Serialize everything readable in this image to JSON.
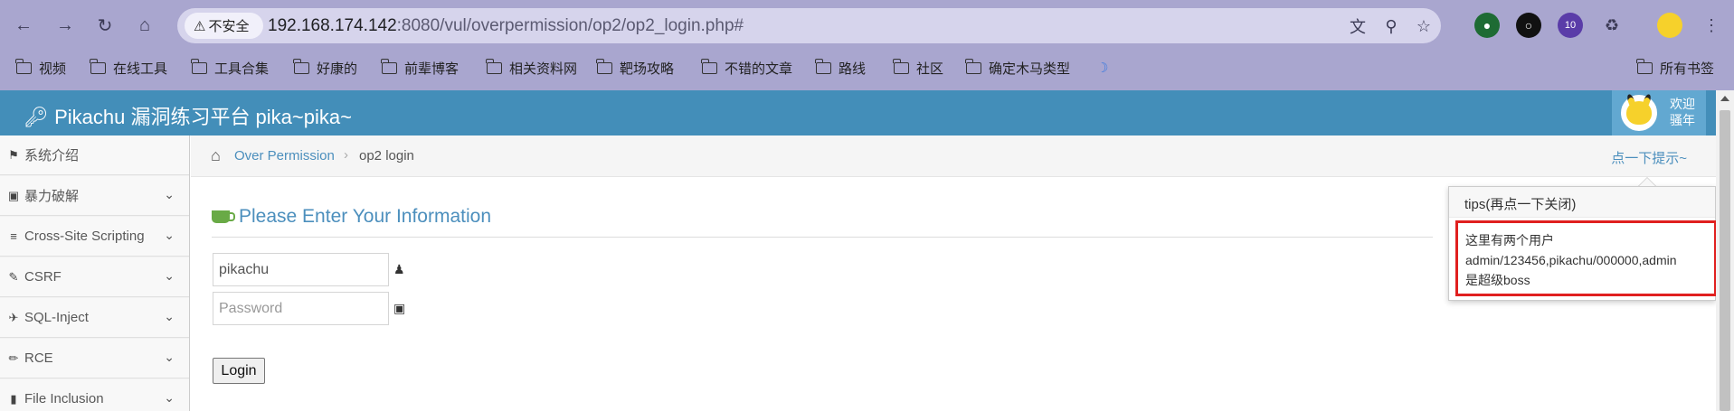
{
  "browser": {
    "insecure_label": "不安全",
    "url_host": "192.168.174.142",
    "url_rest": ":8080/vul/overpermission/op2/op2_login.php#",
    "extension_badge": "10",
    "bookmarks": [
      "视频",
      "在线工具",
      "工具合集",
      "好康的",
      "前辈博客",
      "相关资料网",
      "靶场攻略",
      "不错的文章",
      "路线",
      "社区",
      "确定木马类型"
    ],
    "all_bookmarks_label": "所有书签"
  },
  "app": {
    "title": "Pikachu 漏洞练习平台 pika~pika~",
    "welcome_line1": "欢迎",
    "welcome_line2": "骚年"
  },
  "sidebar": {
    "items": [
      {
        "label": "系统介绍",
        "icon": "tags-icon"
      },
      {
        "label": "暴力破解",
        "icon": "lock-icon"
      },
      {
        "label": "Cross-Site Scripting",
        "icon": "list-icon"
      },
      {
        "label": "CSRF",
        "icon": "edit-icon"
      },
      {
        "label": "SQL-Inject",
        "icon": "plane-icon"
      },
      {
        "label": "RCE",
        "icon": "pencil-icon"
      },
      {
        "label": "File Inclusion",
        "icon": "file-icon"
      }
    ]
  },
  "breadcrumb": {
    "parent": "Over Permission",
    "current": "op2 login",
    "hint": "点一下提示~"
  },
  "form": {
    "title": "Please Enter Your Information",
    "username_value": "pikachu",
    "password_placeholder": "Password",
    "login_label": "Login"
  },
  "tips": {
    "header": "tips(再点一下关闭)",
    "line1": "这里有两个用户",
    "line2": "admin/123456,pikachu/000000,admin",
    "line3": "是超级boss"
  }
}
